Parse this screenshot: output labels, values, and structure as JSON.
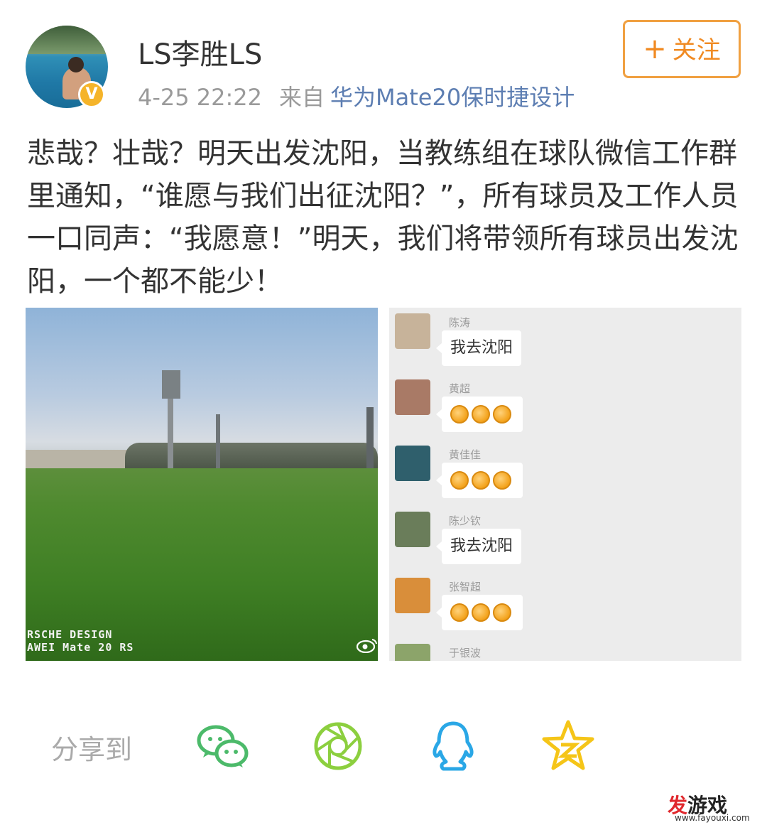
{
  "header": {
    "username": "LS李胜LS",
    "date": "4-25 22:22",
    "from_label": "来自",
    "device": "华为Mate20保时捷设计",
    "follow_plus": "+",
    "follow_label": "关注"
  },
  "post": {
    "text": "悲哉？壮哉？明天出发沈阳，当教练组在球队微信工作群里通知，“谁愿与我们出征沈阳？”，所有球员及工作人员一口同声：“我愿意！”明天，我们将带领所有球员出发沈阳，一个都不能少！"
  },
  "photo": {
    "watermark_line1": "RSCHE DESIGN",
    "watermark_line2": "AWEI Mate 20 RS"
  },
  "chat": {
    "messages": [
      {
        "name": "陈涛",
        "text": "我去沈阳",
        "avatar_color": "#c7b39a",
        "fists": 0
      },
      {
        "name": "黄超",
        "text": "",
        "avatar_color": "#a97a66",
        "fists": 3
      },
      {
        "name": "黄佳佳",
        "text": "",
        "avatar_color": "#2f5f6c",
        "fists": 3
      },
      {
        "name": "陈少钦",
        "text": "我去沈阳",
        "avatar_color": "#6a7d5a",
        "fists": 0
      },
      {
        "name": "张智超",
        "text": "",
        "avatar_color": "#d98e3a",
        "fists": 3
      },
      {
        "name": "于银波",
        "text": "",
        "avatar_color": "#8ca46a",
        "fists": 0
      }
    ]
  },
  "share": {
    "label": "分享到",
    "targets": [
      "wechat-icon",
      "moments-icon",
      "qq-icon",
      "qzone-icon"
    ]
  },
  "watermark": {
    "brand_red": "发",
    "brand_rest": "游戏",
    "url": "www.fayouxi.com"
  },
  "colors": {
    "follow": "#f08a22",
    "link": "#5d7eb2",
    "wechat": "#4cba6a",
    "moments": "#8ccf3f",
    "qq": "#2aa7e6",
    "qzone": "#f5c518"
  }
}
